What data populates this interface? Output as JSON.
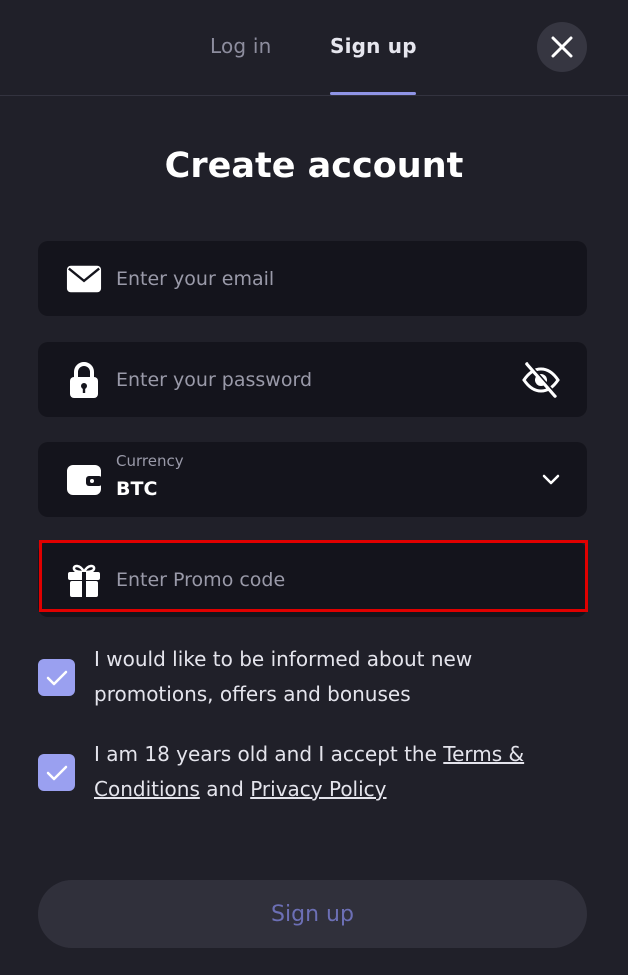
{
  "tabs": {
    "login_label": "Log in",
    "signup_label": "Sign up"
  },
  "title": "Create account",
  "email": {
    "placeholder": "Enter your email",
    "icon": "envelope-icon"
  },
  "password": {
    "placeholder": "Enter your password",
    "icon": "lock-icon",
    "toggle_icon": "eye-off-icon"
  },
  "currency": {
    "label": "Currency",
    "value": "BTC",
    "icon": "wallet-icon"
  },
  "promo": {
    "placeholder": "Enter Promo code",
    "icon": "gift-icon",
    "highlighted": true,
    "highlight_color": "#e00000"
  },
  "checkboxes": {
    "promotions": {
      "checked": true,
      "text": "I would like to be informed about new promotions, offers and bonuses"
    },
    "terms": {
      "checked": true,
      "prefix": "I am 18 years old and I accept the ",
      "terms_link": "Terms & Conditions",
      "middle": " and ",
      "privacy_link": "Privacy Policy"
    }
  },
  "submit_label": "Sign up",
  "colors": {
    "background": "#202029",
    "field_bg": "#14141c",
    "accent": "#8f94e6",
    "checkbox": "#9aa0f0"
  }
}
